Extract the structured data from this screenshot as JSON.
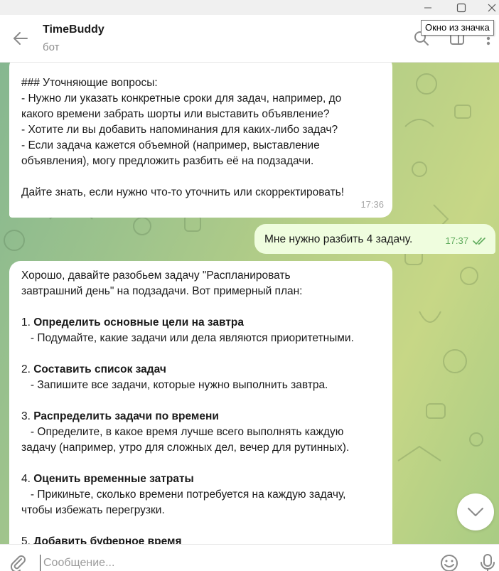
{
  "tooltip": {
    "text": "Окно из значка"
  },
  "header": {
    "title": "TimeBuddy",
    "subtitle": "бот"
  },
  "messages": {
    "m1": {
      "lines": [
        "### Уточняющие вопросы:",
        "- Нужно ли указать конкретные сроки для задач, например, до",
        "какого времени забрать шорты или выставить объявление?",
        "- Хотите ли вы добавить напоминания для каких-либо задач?",
        "- Если задача кажется объемной (например, выставление",
        "объявления), могу предложить разбить её на подзадачи.",
        "Дайте знать, если нужно что-то уточнить или скорректировать!"
      ],
      "time": "17:36"
    },
    "m2": {
      "text": "Мне нужно разбить 4 задачу.",
      "time": "17:37"
    },
    "m3": {
      "intro1": "Хорошо, давайте разобьем задачу \"Распланировать",
      "intro2": "завтрашний день\" на подзадачи. Вот примерный план:",
      "s1_num": "1. ",
      "s1_title": "Определить основные цели на завтра",
      "s1_desc": "   - Подумайте, какие задачи или дела являются приоритетными.",
      "s2_num": "2. ",
      "s2_title": "Составить список задач",
      "s2_desc": "   - Запишите все задачи, которые нужно выполнить завтра.",
      "s3_num": "3. ",
      "s3_title": "Распределить задачи по времени",
      "s3_desc1": "   - Определите, в какое время лучше всего выполнять каждую",
      "s3_desc2": "задачу (например, утро для сложных дел, вечер для рутинных).",
      "s4_num": "4. ",
      "s4_title": "Оценить временные затраты",
      "s4_desc1": "   - Прикиньте, сколько времени потребуется на каждую задачу,",
      "s4_desc2": "чтобы избежать перегрузки.",
      "s5_num": "5. ",
      "s5_title": "Добавить буферное время"
    }
  },
  "composer": {
    "placeholder": "Сообщение..."
  },
  "colors": {
    "accent": "#5fab5c",
    "outgoing_bubble": "#effdde"
  }
}
